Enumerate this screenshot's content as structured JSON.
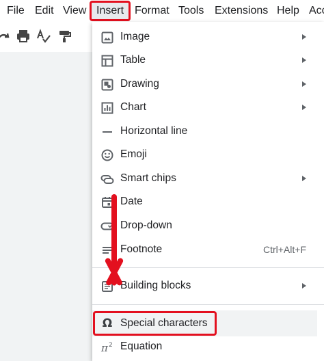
{
  "menubar": {
    "items": [
      "File",
      "Edit",
      "View",
      "Insert",
      "Format",
      "Tools",
      "Extensions",
      "Help",
      "Acc"
    ]
  },
  "toolbar": {
    "icons": [
      "redo-icon",
      "print-icon",
      "spellcheck-icon",
      "paint-format-icon"
    ]
  },
  "insert_menu": {
    "items": [
      {
        "label": "Image",
        "icon": "image-icon",
        "submenu": true
      },
      {
        "label": "Table",
        "icon": "table-icon",
        "submenu": true
      },
      {
        "label": "Drawing",
        "icon": "drawing-icon",
        "submenu": true
      },
      {
        "label": "Chart",
        "icon": "chart-icon",
        "submenu": true
      },
      {
        "label": "Horizontal line",
        "icon": "horizontal-line-icon",
        "submenu": false
      },
      {
        "label": "Emoji",
        "icon": "emoji-icon",
        "submenu": false
      },
      {
        "label": "Smart chips",
        "icon": "smart-chips-icon",
        "submenu": true
      },
      {
        "label": "Date",
        "icon": "calendar-icon",
        "submenu": false
      },
      {
        "label": "Drop-down",
        "icon": "dropdown-icon",
        "submenu": false
      },
      {
        "label": "Footnote",
        "icon": "footnote-icon",
        "submenu": false,
        "shortcut": "Ctrl+Alt+F"
      },
      {
        "label": "Building blocks",
        "icon": "building-blocks-icon",
        "submenu": true
      },
      {
        "label": "Special characters",
        "icon": "omega-icon",
        "submenu": false
      },
      {
        "label": "Equation",
        "icon": "pi-squared-icon",
        "submenu": false
      }
    ]
  },
  "colors": {
    "highlight_red": "#e3101f",
    "menu_hover": "#f1f3f4",
    "icon_grey": "#5f6368"
  }
}
